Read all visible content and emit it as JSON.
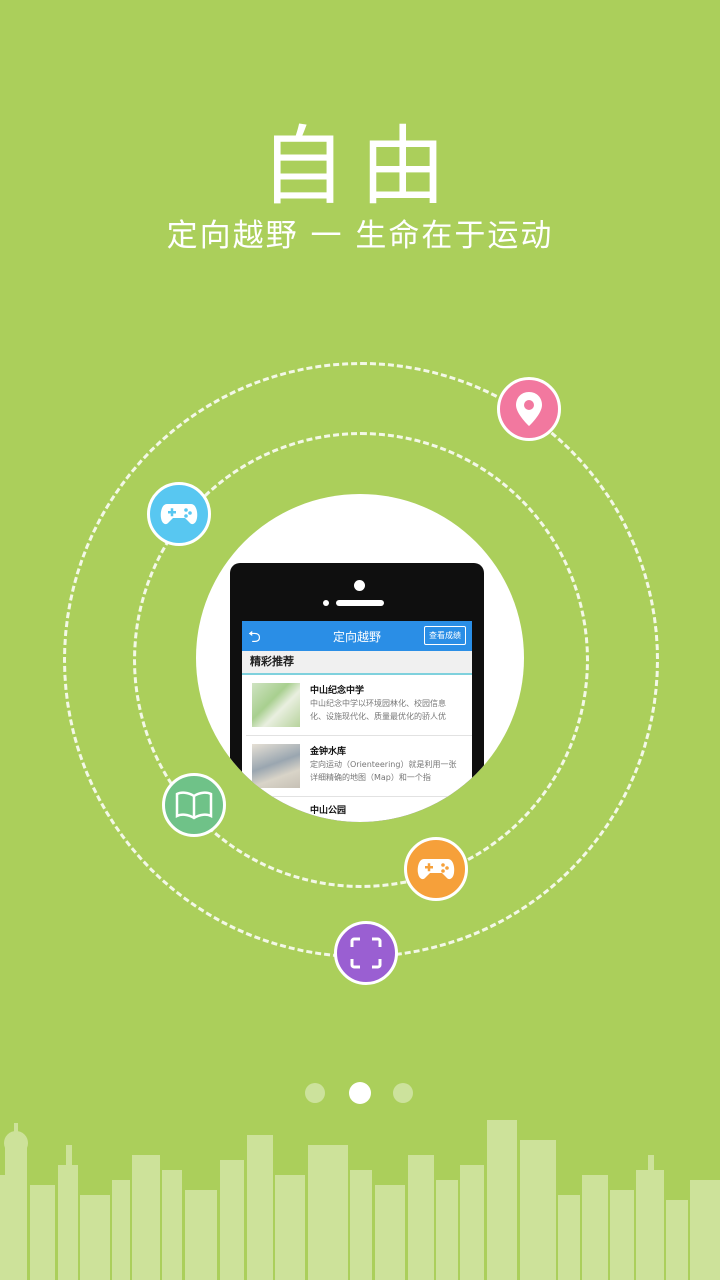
{
  "header": {
    "title": "自由",
    "subtitle": "定向越野 一 生命在于运动"
  },
  "phone_app": {
    "title": "定向越野",
    "action_button": "查看成绩",
    "section_title": "精彩推荐",
    "items": [
      {
        "title": "中山纪念中学",
        "desc": "中山纪念中学以环境园林化、校园信息化、设施现代化、质量最优化的骄人优"
      },
      {
        "title": "金钟水库",
        "desc": "定向运动（Orienteering）就是利用一张详细精确的地图（Map）和一个指"
      },
      {
        "title": "中山公园",
        "desc": ""
      }
    ]
  },
  "icons": {
    "pink": "location-pin-icon",
    "blue": "gamepad-icon",
    "green": "book-icon",
    "orange": "gamepad-icon",
    "purple": "scan-icon"
  },
  "pagination": {
    "total": 3,
    "active_index": 1
  },
  "colors": {
    "background": "#abcf5b",
    "pink": "#f2789f",
    "blue": "#58c7f1",
    "green": "#6fc288",
    "orange": "#f6a03a",
    "purple": "#9a5fd2",
    "app_bar": "#2a8ee6"
  }
}
